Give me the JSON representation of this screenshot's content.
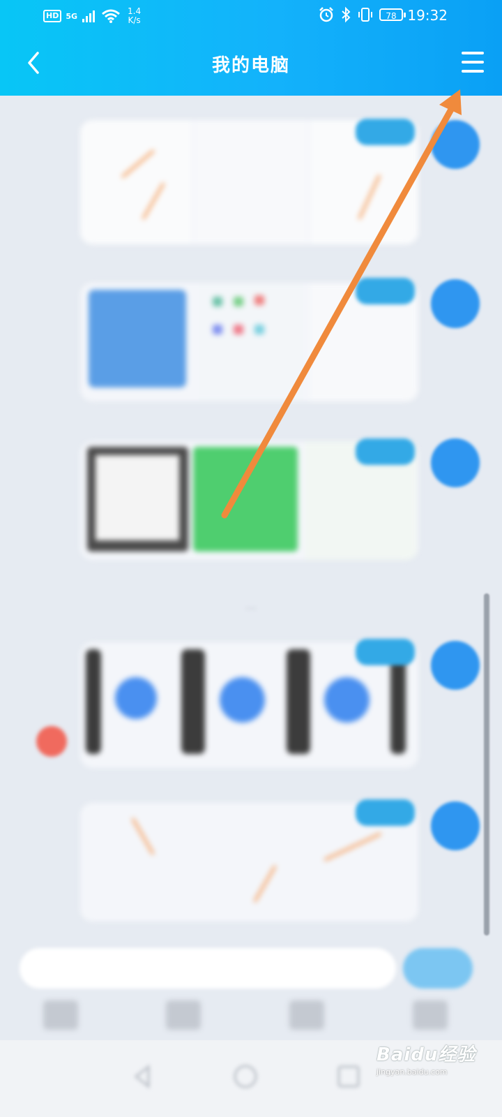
{
  "status_bar": {
    "hd": "HD",
    "network": "5G",
    "speed_value": "1.4",
    "speed_unit": "K/s",
    "battery": "78",
    "time": "19:32"
  },
  "header": {
    "title": "我的电脑"
  },
  "watermark": {
    "brand": "Baidu经验",
    "url": "jingyan.baidu.com"
  },
  "colors": {
    "header_gradient_start": "#08c6f6",
    "header_gradient_end": "#0aa0f5",
    "annotation_arrow": "#f08a3c",
    "avatar": "#2f96f0"
  },
  "icons": {
    "back": "chevron-left-icon",
    "menu": "hamburger-menu-icon",
    "alarm": "alarm-icon",
    "bluetooth": "bluetooth-icon",
    "vibrate": "vibrate-icon",
    "wifi": "wifi-icon",
    "signal": "signal-icon"
  }
}
